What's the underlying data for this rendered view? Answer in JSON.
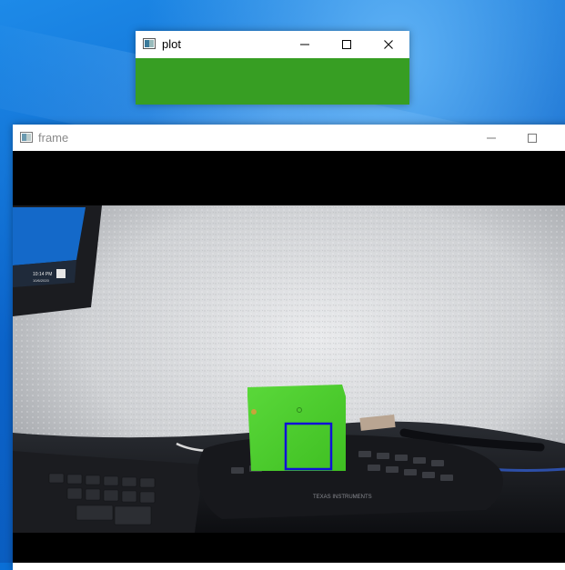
{
  "plot_window": {
    "title": "plot",
    "color": "#379e23",
    "controls": [
      "minimize",
      "maximize",
      "close"
    ]
  },
  "frame_window": {
    "title": "frame",
    "controls": [
      "minimize",
      "maximize"
    ]
  },
  "scene": {
    "tracked_object_color": "#4ccf2a",
    "tracking_box_color": "#1010d8",
    "monitor_clock_time": "10:14 PM",
    "monitor_clock_date": "10/6/2020",
    "calculator_brand": "TEXAS INSTRUMENTS"
  }
}
